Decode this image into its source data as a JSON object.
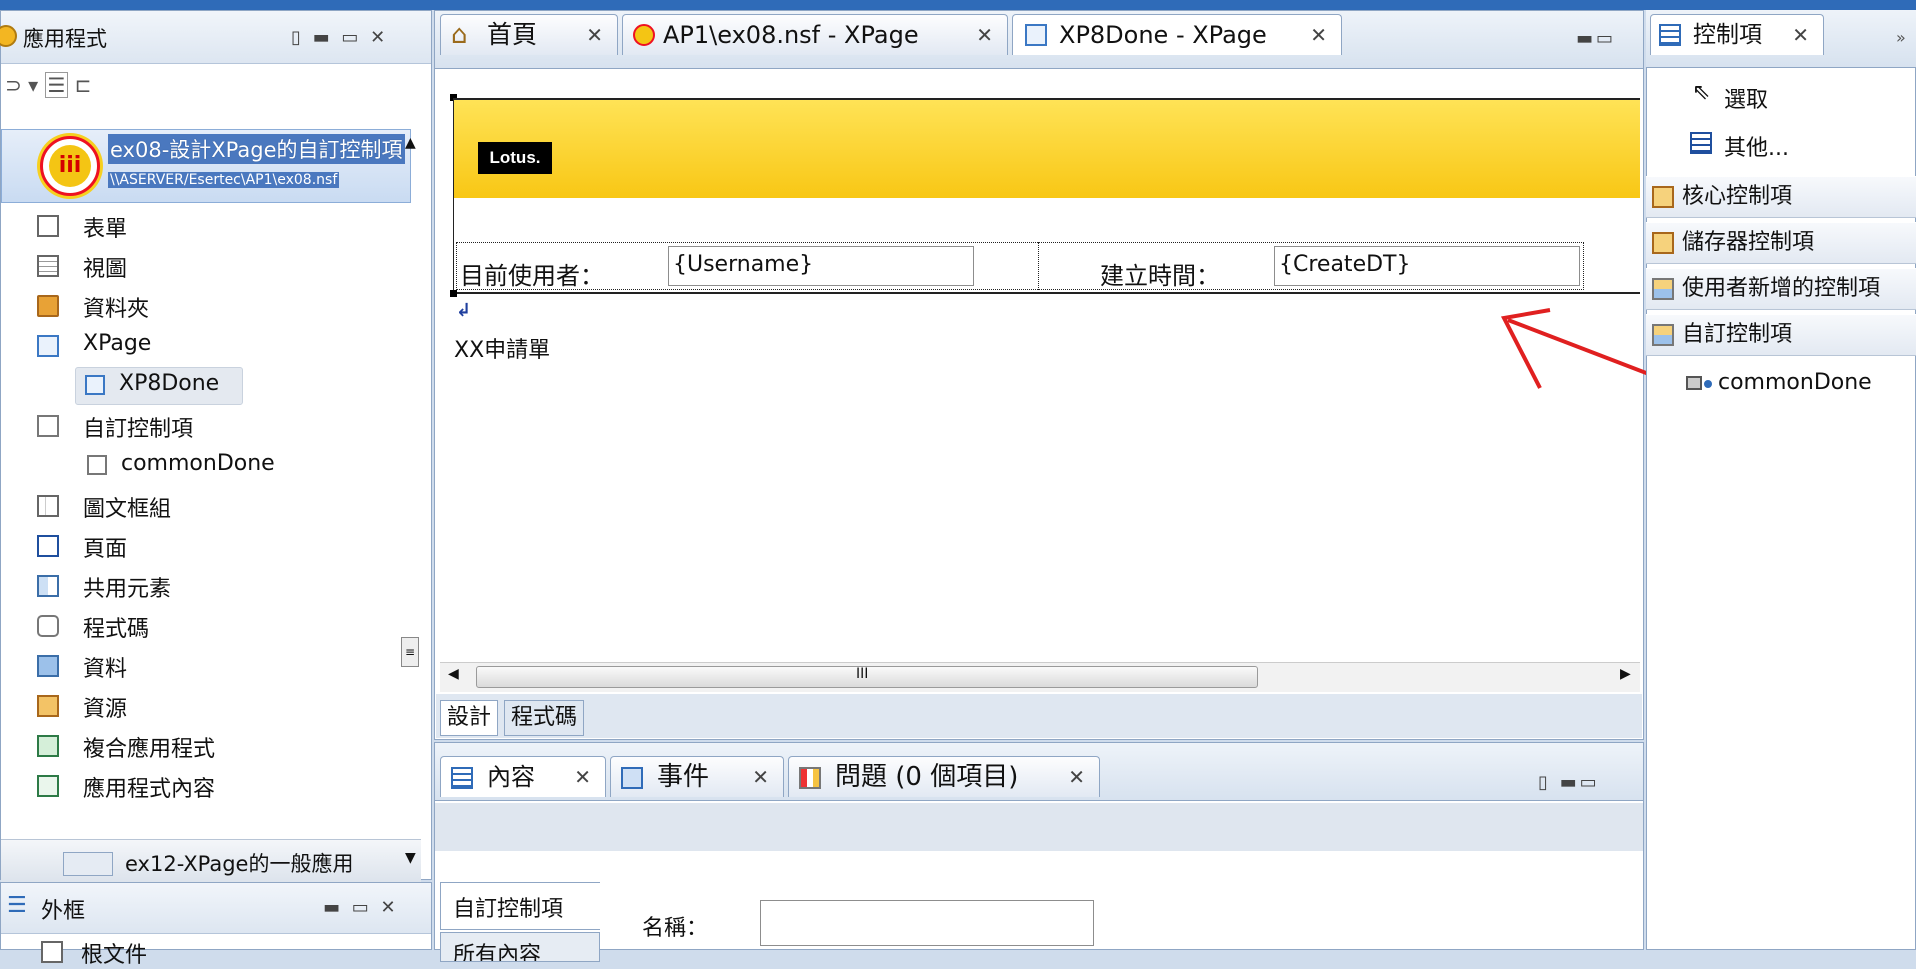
{
  "nav": {
    "title": "應用程式",
    "app_selected": {
      "name": "ex08-設計XPage的自訂控制項",
      "path": "\\\\ASERVER/Esertec\\AP1\\ex08.nsf"
    },
    "items": [
      "表單",
      "視圖",
      "資料夾",
      "XPage",
      "XP8Done",
      "自訂控制項",
      "commonDone",
      "圖文框組",
      "頁面",
      "共用元素",
      "程式碼",
      "資料",
      "資源",
      "複合應用程式",
      "應用程式內容"
    ],
    "app_other": "ex12-XPage的一般應用",
    "outline_title": "外框",
    "outline_item": "根文件"
  },
  "editor": {
    "tabs": [
      "首頁",
      "AP1\\ex08.nsf - XPage",
      "XP8Done - XPage"
    ],
    "logo_text": "Lotus.",
    "user_label": "目前使用者：",
    "user_value": "{Username}",
    "created_label": "建立時間：",
    "created_value": "{CreateDT}",
    "body_text": "XX申請單",
    "scroll_grip": "III",
    "bottom_tabs": [
      "設計",
      "程式碼"
    ]
  },
  "props": {
    "tabs": [
      "內容",
      "事件",
      "問題 (0 個項目)"
    ],
    "side_tabs": [
      "自訂控制項",
      "所有內容"
    ],
    "name_label": "名稱："
  },
  "palette": {
    "title": "控制項",
    "select": "選取",
    "other": "其他...",
    "sections": [
      "核心控制項",
      "儲存器控制項",
      "使用者新增的控制項",
      "自訂控制項"
    ],
    "custom_item": "commonDone"
  },
  "colors": {
    "accent": "#2f6bb8",
    "selection": "#dfe9f7",
    "banner": "#f8c715",
    "annotation_arrow": "#e02020"
  }
}
